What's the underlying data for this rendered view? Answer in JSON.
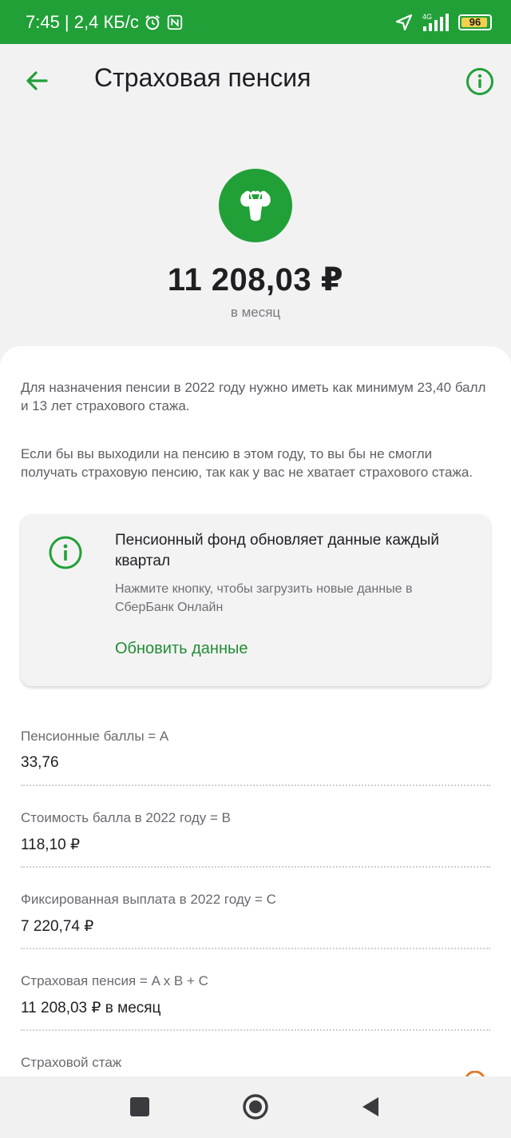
{
  "status_bar": {
    "time_speed": "7:45 | 2,4 КБ/с",
    "network": "4G",
    "battery": "96",
    "battery_level": 0.96
  },
  "header": {
    "title": "Страховая пенсия",
    "back_icon": "arrow-left-icon",
    "info_icon": "info-circle-icon"
  },
  "hero": {
    "amount": "11 208,03 ₽",
    "period": "в месяц"
  },
  "info": {
    "paragraph1": "Для назначения пенсии в 2022 году нужно иметь как минимум 23,40 балл и 13 лет страхового стажа.",
    "paragraph2": "Если бы вы выходили на пенсию в этом году, то вы бы не смогли получать страховую пенсию, так как у вас не хватает страхового стажа."
  },
  "card": {
    "title": "Пенсионный фонд обновляет данные каждый квартал",
    "subtitle": "Нажмите кнопку, чтобы загрузить новые данные в СберБанк Онлайн",
    "action": "Обновить данные"
  },
  "rows": [
    {
      "label": "Пенсионные баллы = A",
      "value": "33,76"
    },
    {
      "label": "Стоимость балла в 2022 году = B",
      "value": "118,10 ₽"
    },
    {
      "label": "Фиксированная выплата в 2022 году = C",
      "value": "7 220,74 ₽"
    },
    {
      "label": "Страховая пенсия = A x B + C",
      "value": "11 208,03 ₽ в месяц"
    },
    {
      "label": "Страховой стаж",
      "value": ""
    }
  ],
  "colors": {
    "brand_green": "#21a038",
    "link_green": "#218c35"
  }
}
